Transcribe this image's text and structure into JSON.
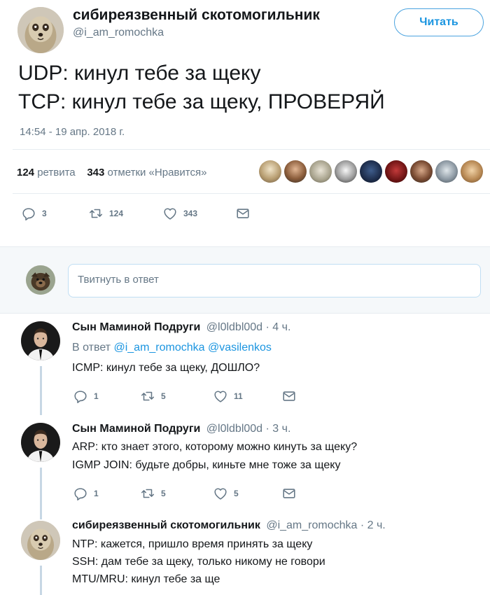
{
  "main_tweet": {
    "author_name": "сибиреязвенный скотомогильник",
    "author_handle": "@i_am_romochka",
    "follow_label": "Читать",
    "text_lines": [
      "UDP: кинул тебе за щеку",
      "TCP: кинул тебе за щеку, ПРОВЕРЯЙ"
    ],
    "timestamp": "14:54 - 19 апр. 2018 г.",
    "retweets_count": "124",
    "retweets_label": "ретвита",
    "likes_count": "343",
    "likes_label": "отметки «Нравится»",
    "likers_count": 9,
    "actions": {
      "replies": "3",
      "retweets": "124",
      "likes": "343"
    }
  },
  "reply_box": {
    "placeholder": "Твитнуть в ответ"
  },
  "replies": [
    {
      "name": "Сын Маминой Подруги",
      "meta": "@l0ldbl00d · 4 ч.",
      "reply_to_prefix": "В ответ",
      "reply_to_mentions": "@i_am_romochka @vasilenkos",
      "lines": [
        "ICMP: кинул тебе за щеку, ДОШЛО?"
      ],
      "actions": {
        "replies": "1",
        "retweets": "5",
        "likes": "11"
      }
    },
    {
      "name": "Сын Маминой Подруги",
      "meta": "@l0ldbl00d · 3 ч.",
      "lines": [
        "ARP: кто знает этого, которому можно кинуть за щеку?",
        "IGMP JOIN: будьте добры, киньте мне тоже за щеку"
      ],
      "actions": {
        "replies": "1",
        "retweets": "5",
        "likes": "5"
      }
    },
    {
      "name": "сибиреязвенный скотомогильник",
      "meta": "@i_am_romochka · 2 ч.",
      "lines": [
        "NTP: кажется, пришло время принять за щеку",
        "SSH: дам тебе за щеку, только никому не говори",
        "MTU/MRU: кинул тебе за ще"
      ]
    }
  ],
  "colors": {
    "accent": "#1b95e0",
    "text_primary": "#14171a",
    "text_secondary": "#657786",
    "icon": "#657786",
    "reply_bg": "#f5f8fa",
    "thread_line": "#c7d7e4"
  }
}
